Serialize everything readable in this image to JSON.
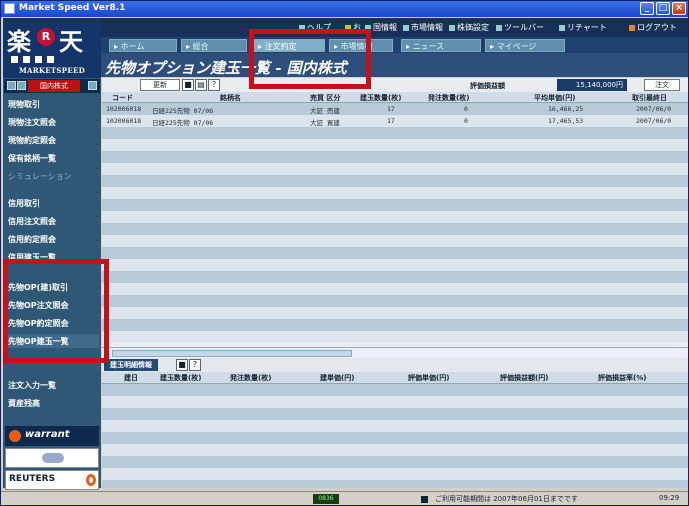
{
  "window": {
    "title": "Market Speed Ver8.1",
    "btn_min": "_",
    "btn_max": "□",
    "btn_close": "×"
  },
  "logo": {
    "raku": "楽",
    "r": "R",
    "ten": "天",
    "market_speed": "MARKETSPEED"
  },
  "topmenu": {
    "items": [
      "ヘルプ",
      "お",
      "国情報",
      "市場情報",
      "株価設定",
      "ツールバー",
      "リチャート",
      "ログアウト"
    ]
  },
  "tabs": [
    "ホーム",
    "総合",
    "注文約定",
    "市場情報",
    "ニュース",
    "マイページ"
  ],
  "page_title": "先物オプション建玉一覧 ‐ 国内株式",
  "leftnav": {
    "select_label": "国内株式",
    "items": [
      {
        "label": "現物取引",
        "style": "bold"
      },
      {
        "label": "現物注文照会",
        "style": "bold"
      },
      {
        "label": "現物約定照会",
        "style": "bold"
      },
      {
        "label": "保有銘柄一覧",
        "style": "bold"
      },
      {
        "label": "シミュレーション",
        "style": "dim"
      },
      {
        "label": "信用取引",
        "style": "bold"
      },
      {
        "label": "信用注文照会",
        "style": "bold"
      },
      {
        "label": "信用約定照会",
        "style": "bold"
      },
      {
        "label": "信用建玉一覧",
        "style": "bold"
      },
      {
        "label": "先物OP(建)取引",
        "style": "bold"
      },
      {
        "label": "先物OP注文照会",
        "style": "bold"
      },
      {
        "label": "先物OP約定照会",
        "style": "bold"
      },
      {
        "label": "先物OP建玉一覧",
        "style": "sel"
      },
      {
        "label": "注文入力一覧",
        "style": "bold"
      },
      {
        "label": "資産残高",
        "style": "bold"
      }
    ],
    "warrant_label": "warrant",
    "reuters_label": "REUTERS"
  },
  "toolbar": {
    "update_label": "更新",
    "summary_label": "評価損益額",
    "summary_value": "15,140,000円",
    "order_label": "注文"
  },
  "grid": {
    "headers": [
      "コード",
      "銘柄名",
      "売買 区分",
      "建玉数量(枚)",
      "発注数量(枚)",
      "平均単価(円)",
      "取引最終日"
    ],
    "rows": [
      [
        "102006018",
        "日経225先物 07/06",
        "大証 売建",
        "17",
        "0",
        "16,466,25",
        "2007/06/0"
      ],
      [
        "102006018",
        "日経225先物 07/06",
        "大証 買建",
        "17",
        "0",
        "17,465,53",
        "2007/06/0"
      ]
    ]
  },
  "lower": {
    "title": "建玉明細情報",
    "headers": [
      "建日",
      "建玉数量(枚)",
      "発注数量(枚)",
      "建単価(円)",
      "評価単価(円)",
      "評価損益額(円)",
      "評価損益率(%)"
    ]
  },
  "status": {
    "badge": "0836",
    "message": "ご利用可能期間は 2007年06月01日までです",
    "time": "09:29"
  }
}
